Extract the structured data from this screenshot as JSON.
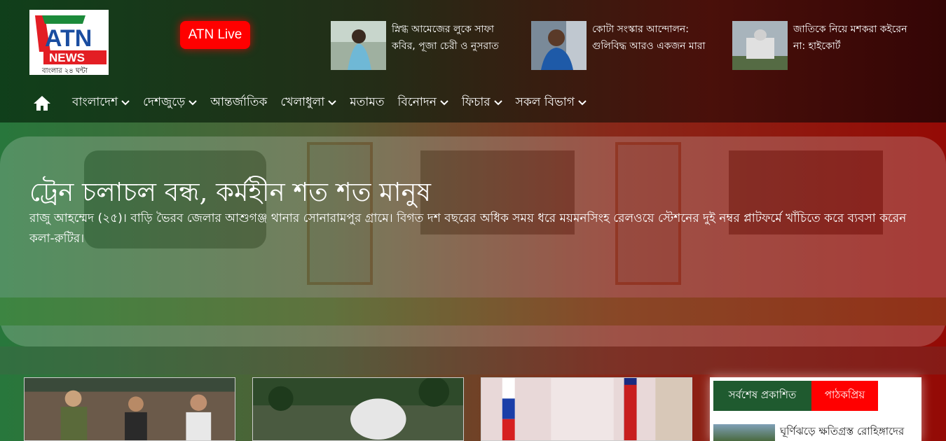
{
  "header": {
    "logo": {
      "text_top": "ATN",
      "text_mid": "NEWS",
      "text_bottom": "বাংলার ২৪ ঘন্টা"
    },
    "live_button": "ATN Live",
    "top_stories": [
      {
        "title": "স্নিগ্ধ আমেজের লুকে সাফা কবির, পূজা চেরী ও নুসরাত"
      },
      {
        "title": "কোটা সংস্কার আন্দোলন: গুলিবিদ্ধ আরও একজন মারা"
      },
      {
        "title": "জাতিকে নিয়ে মশকরা কইরেন না: হাইকোর্ট"
      }
    ]
  },
  "nav": {
    "home_icon": "home-icon",
    "items": [
      {
        "label": "বাংলাদেশ",
        "dropdown": true
      },
      {
        "label": "দেশজুড়ে",
        "dropdown": true
      },
      {
        "label": "আন্তর্জাতিক",
        "dropdown": false
      },
      {
        "label": "খেলাধুলা",
        "dropdown": true
      },
      {
        "label": "মতামত",
        "dropdown": false
      },
      {
        "label": "বিনোদন",
        "dropdown": true
      },
      {
        "label": "ফিচার",
        "dropdown": true
      },
      {
        "label": "সকল বিভাগ",
        "dropdown": true
      }
    ]
  },
  "hero": {
    "headline": "ট্রেন চলাচল বন্ধ, কর্মহীন শত শত মানুষ",
    "lead": "রাজু আহম্মেদ (২৫)। বাড়ি ভৈরব জেলার আশুগঞ্জ থানার সোনারামপুর গ্রামে। বিগত দশ বছরের অধিক সময় ধরে ময়মনসিংহ রেলওয়ে স্টেশনের দুই নম্বর প্লাটফর্মে খাঁচিতে করে ব্যবসা করেন কলা-রুটির।"
  },
  "side_panel": {
    "tab_latest": "সর্বশেষ প্রকাশিত",
    "tab_popular": "পাঠকপ্রিয়",
    "latest_item": "ঘূর্ণিঝড়ে ক্ষতিগ্রস্ত রোহিঙ্গাদের"
  },
  "colors": {
    "brand_green": "#1f5a2f",
    "brand_red": "#ff0000"
  }
}
